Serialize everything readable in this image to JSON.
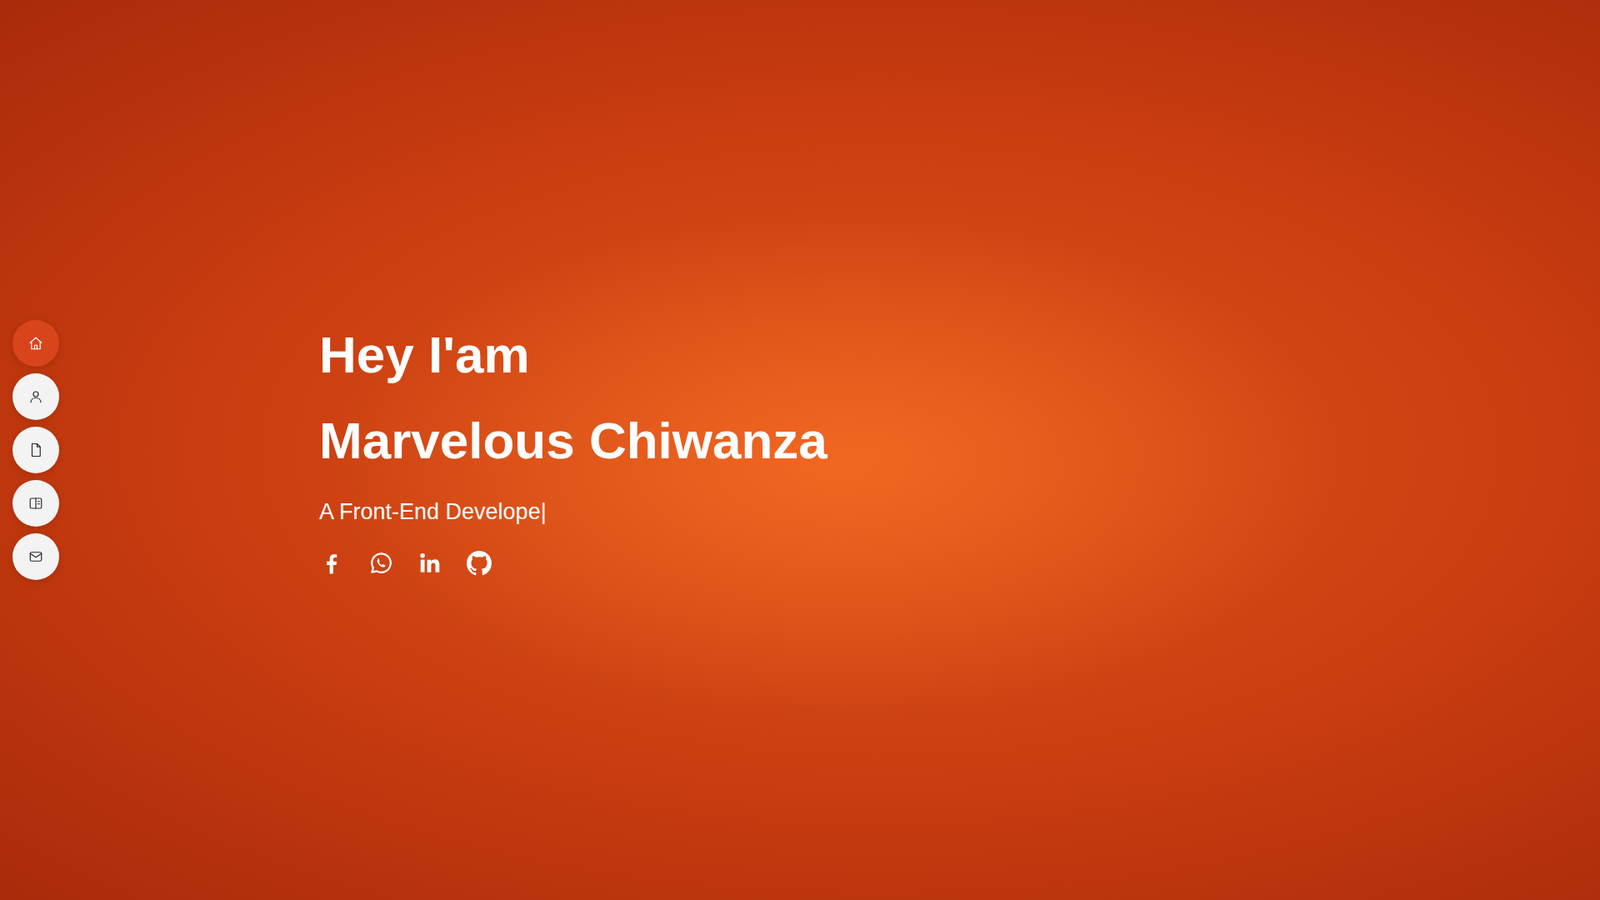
{
  "nav": {
    "items": [
      {
        "selected": true
      },
      {
        "selected": false
      },
      {
        "selected": false
      },
      {
        "selected": false
      },
      {
        "selected": false
      }
    ]
  },
  "hero": {
    "greeting": "Hey I'am",
    "name": "Marvelous Chiwanza",
    "role": "A Front-End Develope",
    "cursor": "|"
  }
}
